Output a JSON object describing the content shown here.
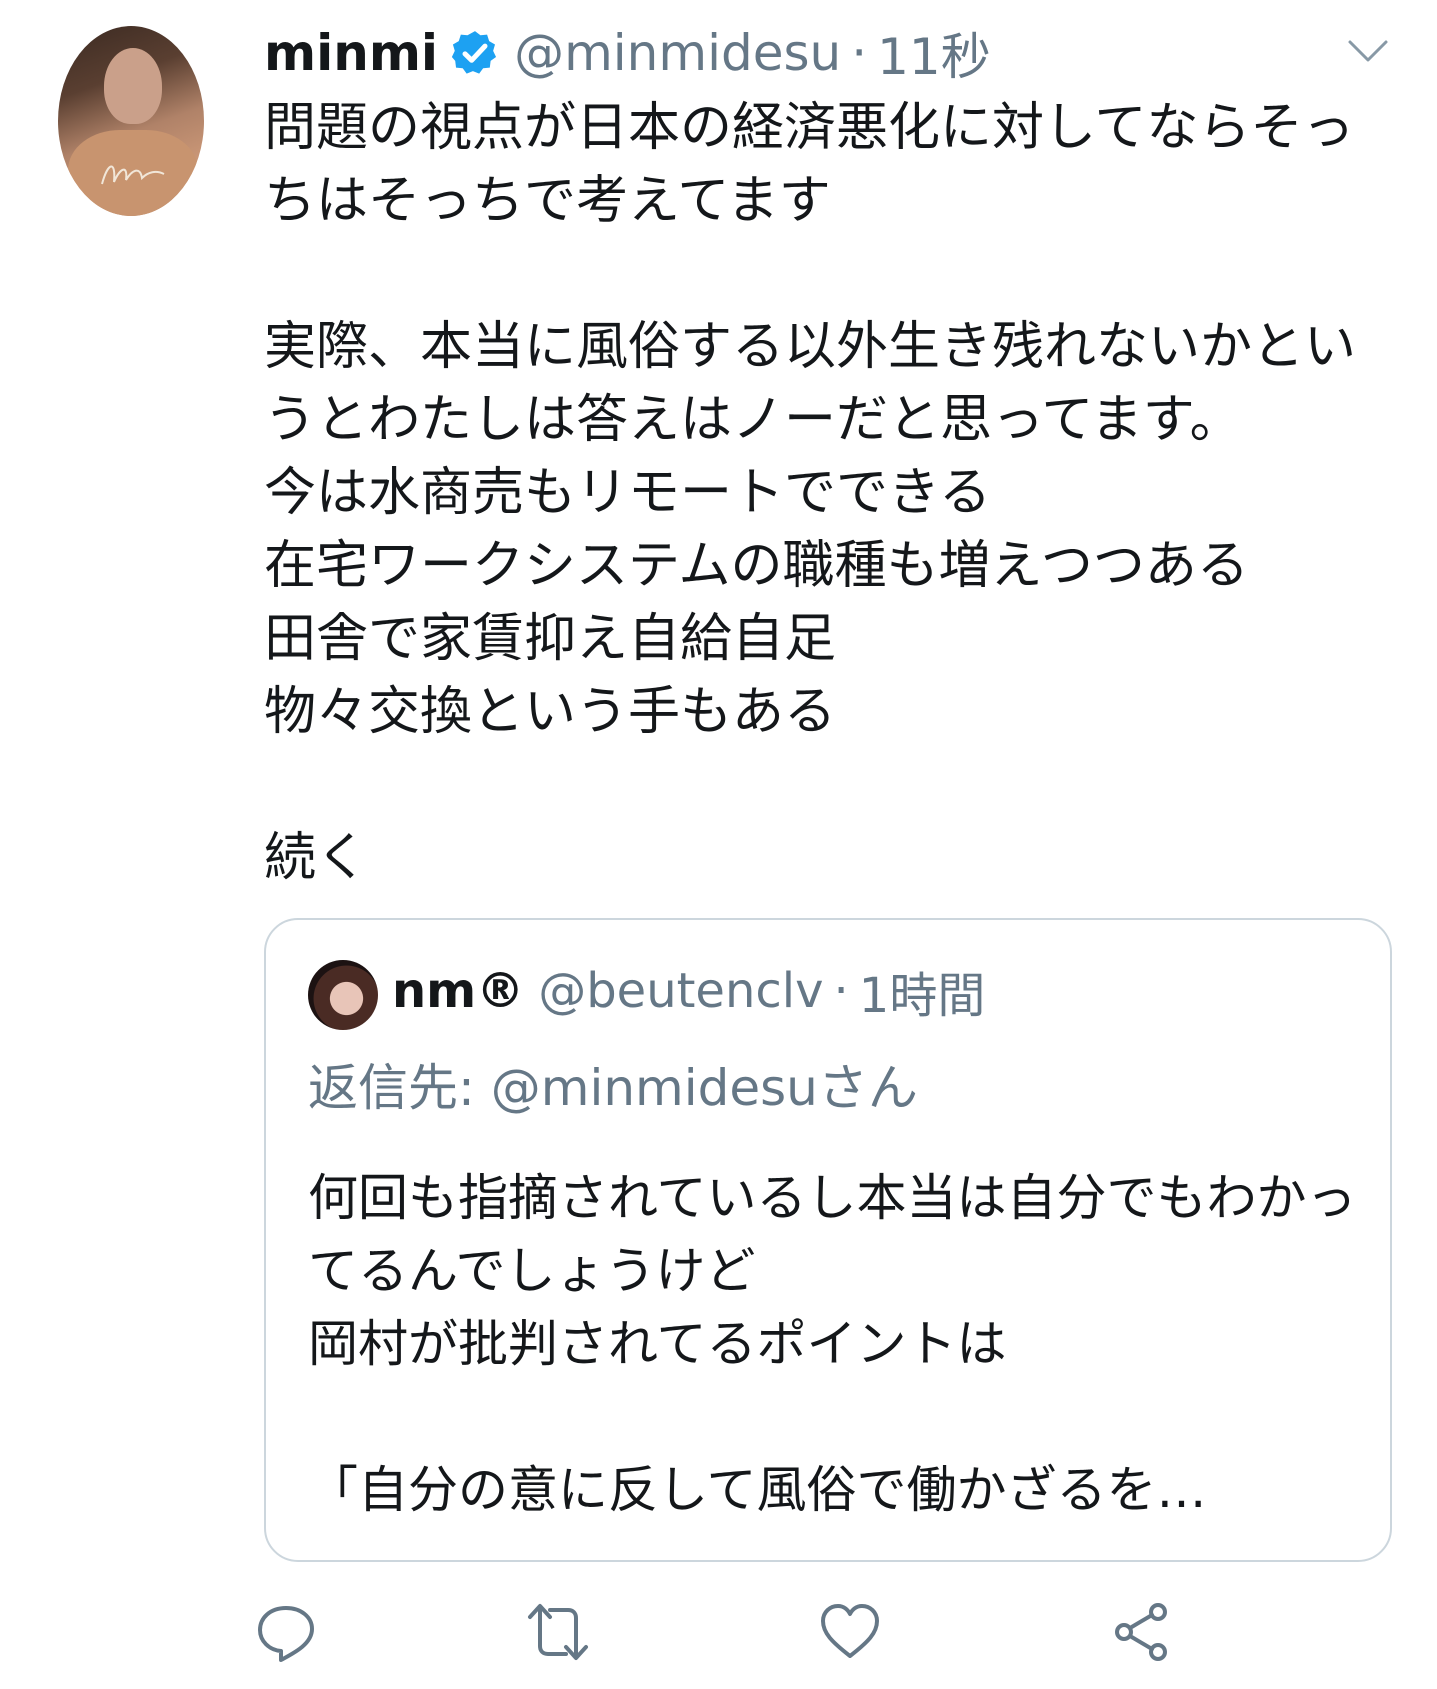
{
  "tweet": {
    "display_name": "minmi",
    "verified_icon": "verified-badge-icon",
    "handle": "@minmidesu",
    "separator": "·",
    "time": "11秒",
    "text": "問題の視点が日本の経済悪化に対してならそっちはそっちで考えてます\n\n実際、本当に風俗する以外生き残れないかというとわたしは答えはノーだと思ってます。\n今は水商売もリモートでできる\n在宅ワークシステムの職種も増えつつある\n田舎で家賃抑え自給自足\n物々交換という手もある\n\n続く"
  },
  "quote": {
    "display_name": "nm®",
    "handle": "@beutenclv",
    "separator": "·",
    "time": "1時間",
    "reply_to": "返信先: @minmidesuさん",
    "text": "何回も指摘されているし本当は自分でもわかってるんでしょうけど\n岡村が批判されてるポイントは\n\n「自分の意に反して風俗で働かざるを…"
  },
  "actions": [
    {
      "name": "reply",
      "icon": "reply-icon"
    },
    {
      "name": "retweet",
      "icon": "retweet-icon"
    },
    {
      "name": "like",
      "icon": "heart-icon"
    },
    {
      "name": "share",
      "icon": "share-icon"
    }
  ],
  "colors": {
    "text": "#14171a",
    "secondary": "#657786",
    "border": "#ccd6dd",
    "verified": "#1da1f2"
  }
}
